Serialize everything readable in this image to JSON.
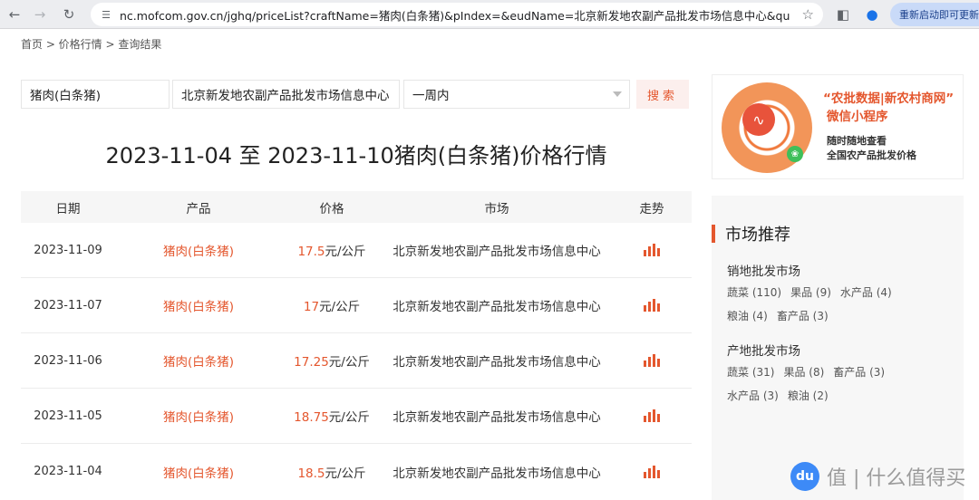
{
  "browser": {
    "url": "nc.mofcom.gov.cn/jghq/priceList?craftName=猪肉(白条猪)&pIndex=&eudName=北京新发地农副产品批发市场信息中心&queryD...",
    "update_label": "重新启动即可更新"
  },
  "breadcrumb": "首页 > 价格行情 > 查询结果",
  "search": {
    "product": "猪肉(白条猪)",
    "market": "北京新发地农副产品批发市场信息中心",
    "period": "一周内",
    "button": "搜索"
  },
  "headline": "2023-11-04 至 2023-11-10猪肉(白条猪)价格行情",
  "table": {
    "headers": [
      "日期",
      "产品",
      "价格",
      "市场",
      "走势"
    ],
    "rows": [
      {
        "date": "2023-11-09",
        "product": "猪肉(白条猪)",
        "price": "17.5",
        "unit": "元/公斤",
        "market": "北京新发地农副产品批发市场信息中心"
      },
      {
        "date": "2023-11-07",
        "product": "猪肉(白条猪)",
        "price": "17",
        "unit": "元/公斤",
        "market": "北京新发地农副产品批发市场信息中心"
      },
      {
        "date": "2023-11-06",
        "product": "猪肉(白条猪)",
        "price": "17.25",
        "unit": "元/公斤",
        "market": "北京新发地农副产品批发市场信息中心"
      },
      {
        "date": "2023-11-05",
        "product": "猪肉(白条猪)",
        "price": "18.75",
        "unit": "元/公斤",
        "market": "北京新发地农副产品批发市场信息中心"
      },
      {
        "date": "2023-11-04",
        "product": "猪肉(白条猪)",
        "price": "18.5",
        "unit": "元/公斤",
        "market": "北京新发地农副产品批发市场信息中心"
      }
    ]
  },
  "promo": {
    "title_line1": "“农批数据|新农村商网”",
    "title_line2": "微信小程序",
    "sub_line1": "随时随地查看",
    "sub_line2": "全国农产品批发价格"
  },
  "recommend": {
    "title": "市场推荐",
    "groups": [
      {
        "title": "销地批发市场",
        "tags": [
          "蔬菜 (110)",
          "果品 (9)",
          "水产品 (4)",
          "粮油 (4)",
          "畜产品 (3)"
        ]
      },
      {
        "title": "产地批发市场",
        "tags": [
          "蔬菜 (31)",
          "果品 (8)",
          "畜产品 (3)",
          "水产品 (3)",
          "粮油 (2)"
        ]
      }
    ]
  },
  "watermark": {
    "logo": "du",
    "text": "值 | 什么值得买"
  },
  "colors": {
    "accent": "#e4572e",
    "header_bg": "#f6f6f6"
  }
}
